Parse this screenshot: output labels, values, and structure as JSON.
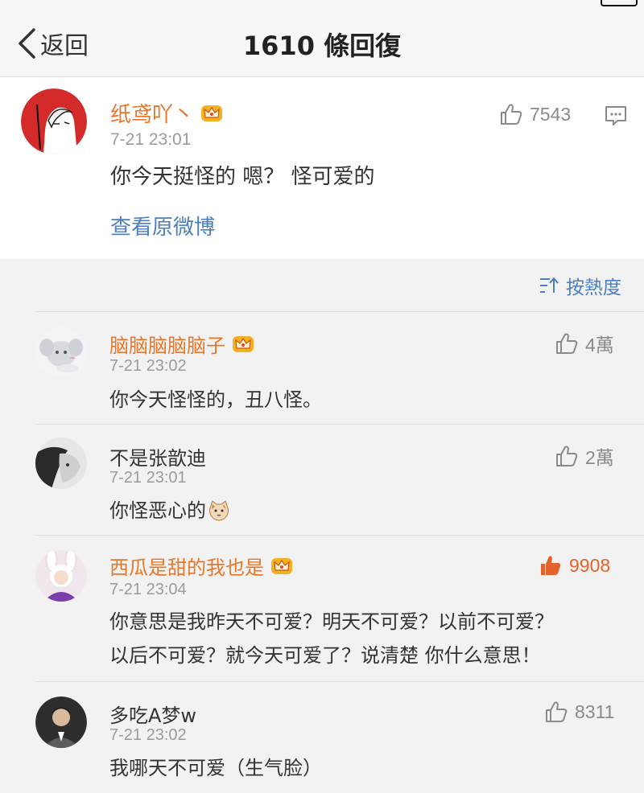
{
  "navbar": {
    "back_label": "返回",
    "title": "1610 條回復"
  },
  "main_comment": {
    "username": "纸鸢吖丶",
    "time": "7-21 23:01",
    "likes": "7543",
    "content": "你今天挺怪的 嗯？ 怪可爱的",
    "view_original": "查看原微博"
  },
  "sort": {
    "label": "按熱度"
  },
  "replies": [
    {
      "username": "脑脑脑脑脑子",
      "vip": true,
      "time": "7-21 23:02",
      "likes": "4萬",
      "liked": false,
      "content": [
        "你今天怪怪的，丑八怪。"
      ]
    },
    {
      "username": "不是张歆迪",
      "vip": false,
      "time": "7-21 23:01",
      "likes": "2萬",
      "liked": false,
      "content": [
        "你怪恶心的"
      ]
    },
    {
      "username": "西瓜是甜的我也是",
      "vip": true,
      "time": "7-21 23:04",
      "likes": "9908",
      "liked": true,
      "content": [
        "你意思是我昨天不可爱？明天不可爱？以前不可爱？",
        "以后不可爱？就今天可爱了？说清楚 你什么意思！"
      ]
    },
    {
      "username": "多吃A梦w",
      "vip": false,
      "time": "7-21 23:02",
      "likes": "8311",
      "liked": false,
      "content": [
        "我哪天不可爱（生气脸）"
      ]
    }
  ],
  "colors": {
    "vip_name": "#e5782c",
    "link": "#4a7fc0",
    "hot_like": "#e5622c"
  }
}
